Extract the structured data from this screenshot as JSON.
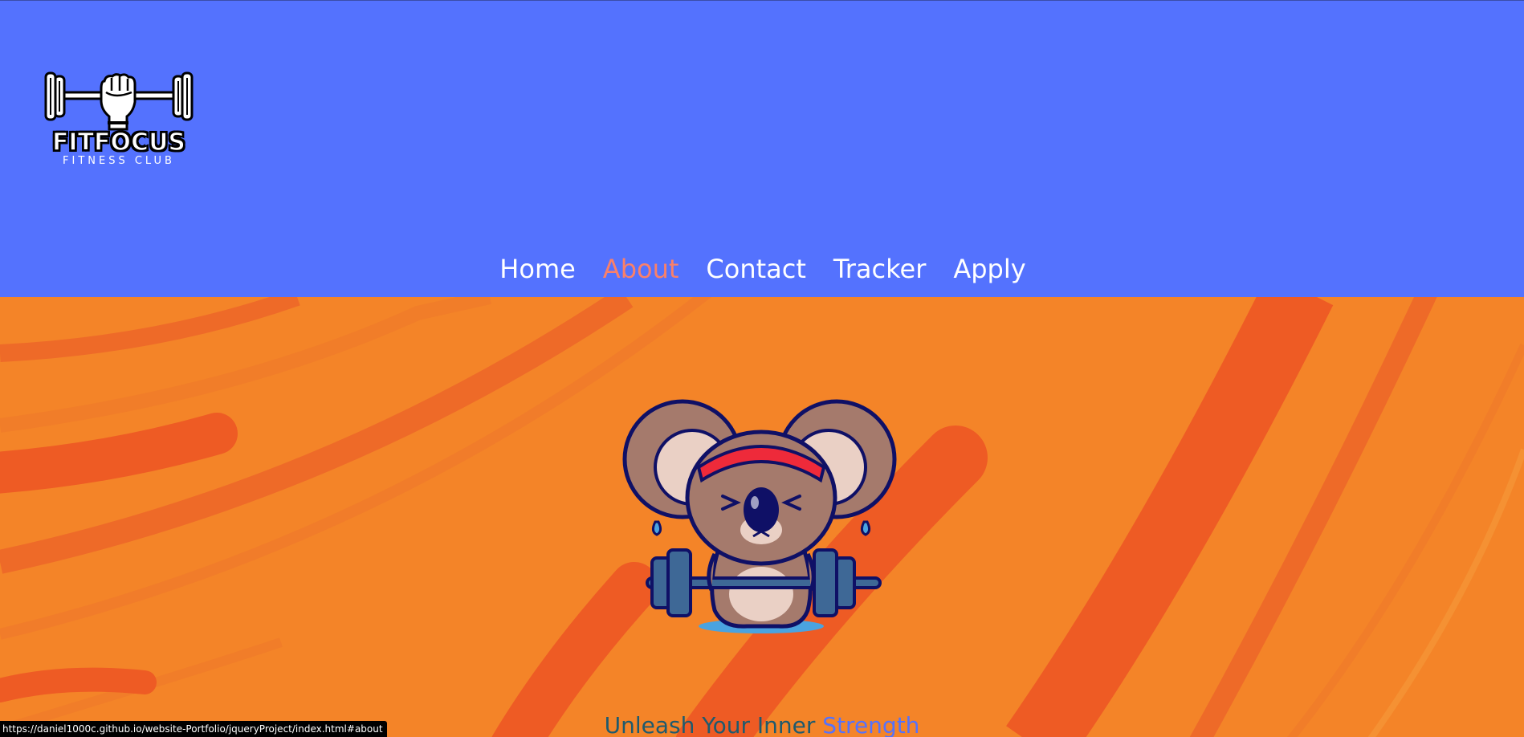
{
  "header": {
    "background_color": "#5472fe",
    "logo": {
      "icon": "fist-barbell-icon",
      "title": "FITFOCUS",
      "subtitle": "FITNESS CLUB"
    },
    "nav": {
      "items": [
        {
          "label": "Home",
          "active": false
        },
        {
          "label": "About",
          "active": true
        },
        {
          "label": "Contact",
          "active": false
        },
        {
          "label": "Tracker",
          "active": false
        },
        {
          "label": "Apply",
          "active": false
        }
      ],
      "active_color": "#fa8069"
    }
  },
  "hero": {
    "background_color": "#f48428",
    "stripe_color": "#ee5b24",
    "mascot": "koala-lifting-barbell-illustration",
    "tagline": {
      "part1": "Unleash Your Inner",
      "part2": "Strength"
    }
  },
  "status_bar": {
    "url": "https://daniel1000c.github.io/website-Portfolio/jqueryProject/index.html#about"
  }
}
